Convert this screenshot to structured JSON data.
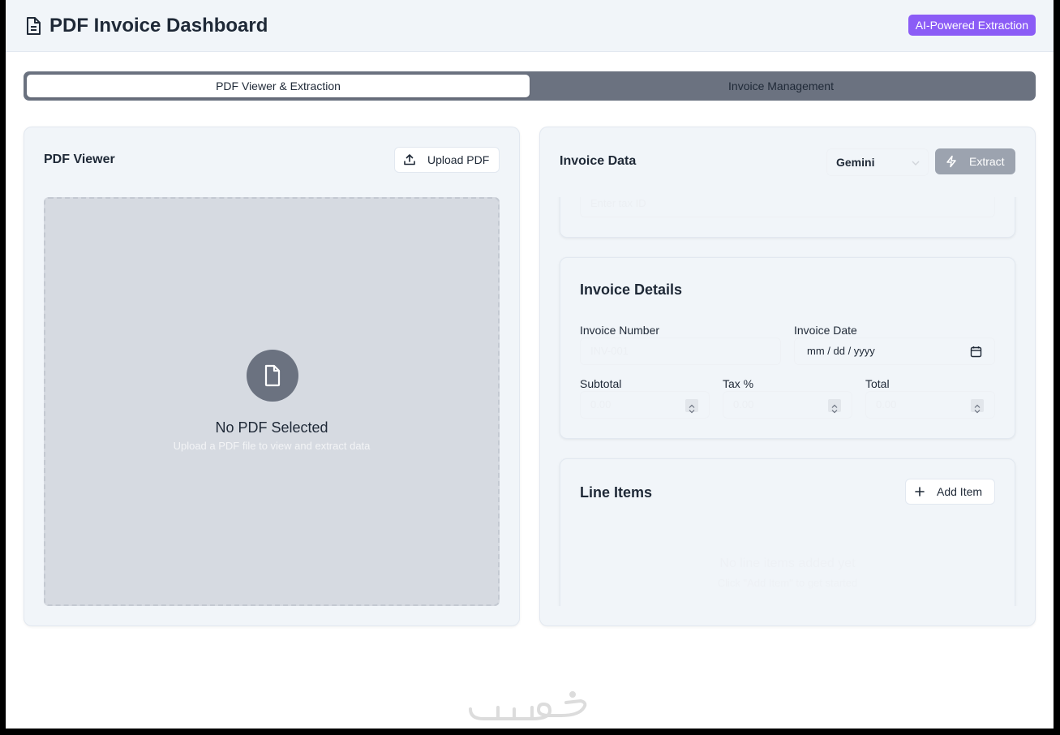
{
  "header": {
    "title": "PDF Invoice Dashboard",
    "badge": "AI-Powered Extraction",
    "badge_color": "#8b5cf6"
  },
  "tabs": [
    {
      "label": "PDF Viewer & Extraction",
      "active": true
    },
    {
      "label": "Invoice Management",
      "active": false
    }
  ],
  "pdf_viewer": {
    "title": "PDF Viewer",
    "upload_label": "Upload PDF",
    "empty_title": "No PDF Selected",
    "empty_subtitle": "Upload a PDF file to view and extract data"
  },
  "invoice_data": {
    "title": "Invoice Data",
    "model": "Gemini",
    "extract_label": "Extract",
    "vendor": {
      "tax_id_placeholder": "Enter tax ID"
    },
    "details": {
      "title": "Invoice Details",
      "invoice_number_label": "Invoice Number",
      "invoice_number_placeholder": "INV-001",
      "invoice_date_label": "Invoice Date",
      "invoice_date_value": "mm / dd / yyyy",
      "subtotal_label": "Subtotal",
      "subtotal_placeholder": "0.00",
      "tax_label": "Tax %",
      "tax_placeholder": "0.00",
      "total_label": "Total",
      "total_placeholder": "0.00"
    },
    "line_items": {
      "title": "Line Items",
      "add_label": "Add Item",
      "empty_title": "No line items added yet",
      "empty_subtitle": "Click \"Add Item\" to get started"
    }
  },
  "watermark": "خمسات"
}
